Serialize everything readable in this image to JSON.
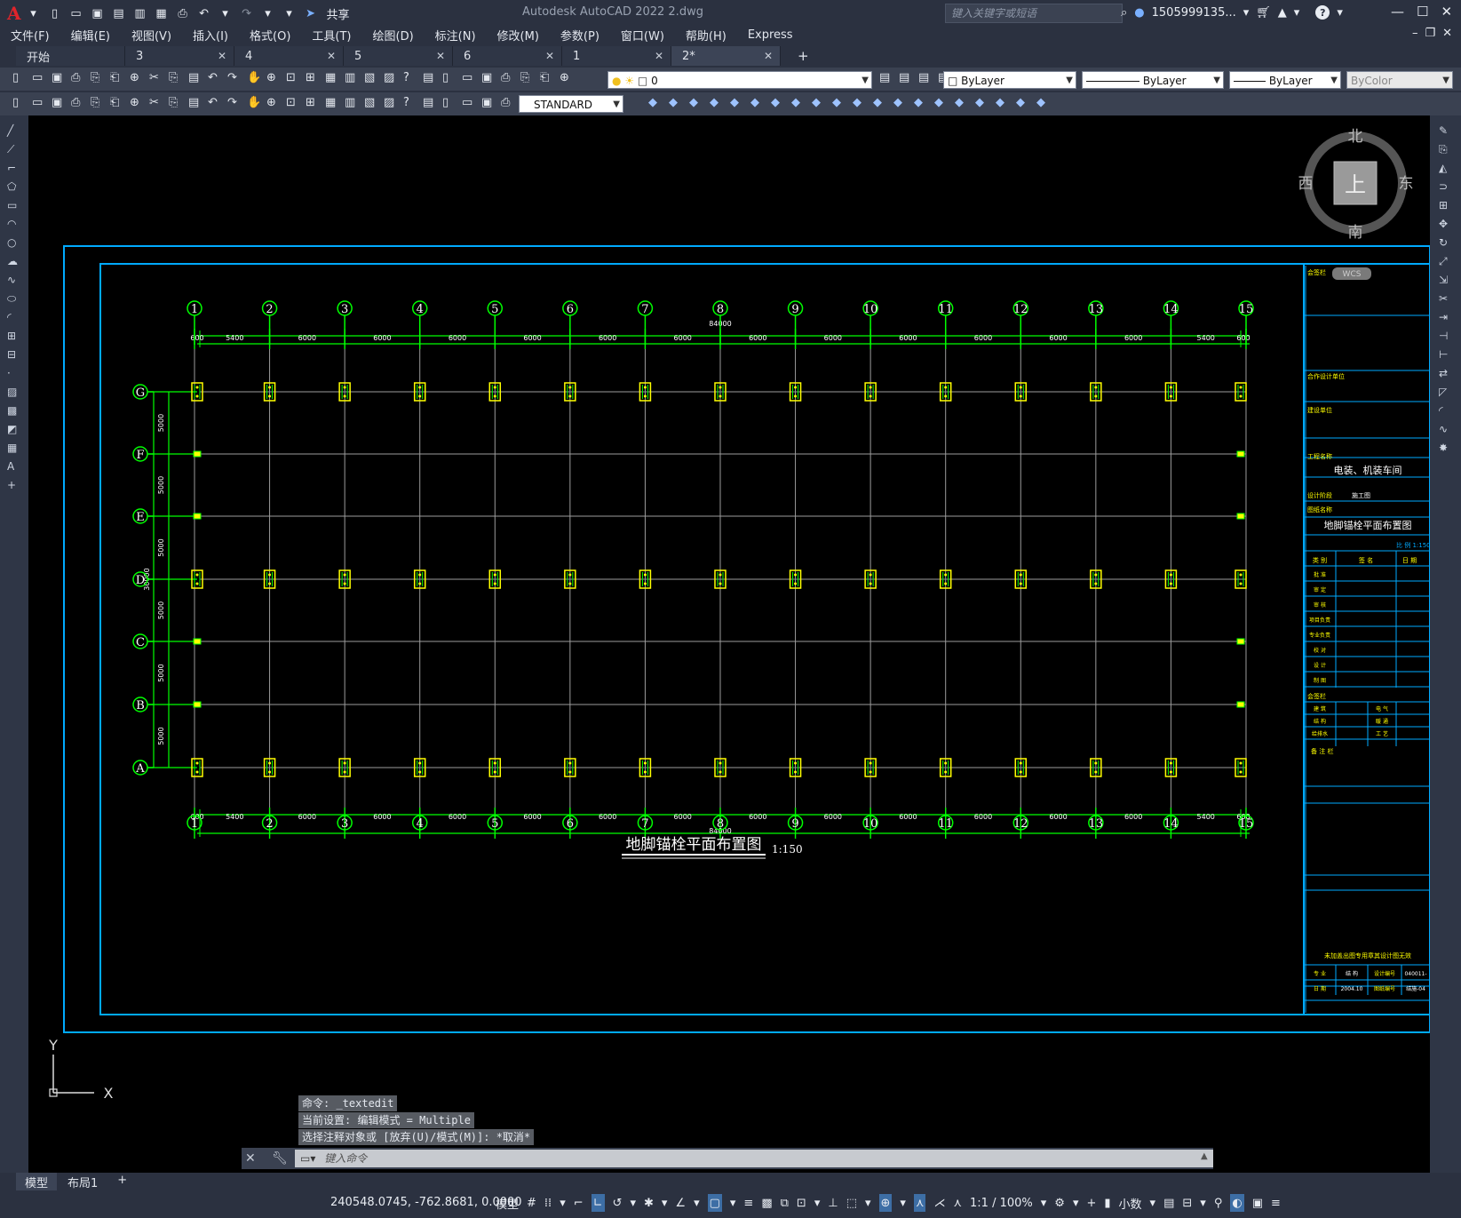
{
  "app": {
    "title": "Autodesk AutoCAD 2022    2.dwg",
    "share_label": "共享",
    "search_placeholder": "键入关键字或短语",
    "user": "1505999135...",
    "logo": "A"
  },
  "menu": [
    "文件(F)",
    "编辑(E)",
    "视图(V)",
    "插入(I)",
    "格式(O)",
    "工具(T)",
    "绘图(D)",
    "标注(N)",
    "修改(M)",
    "参数(P)",
    "窗口(W)",
    "帮助(H)",
    "Express"
  ],
  "file_tabs": [
    {
      "label": "开始",
      "close": "",
      "active": false
    },
    {
      "label": "3",
      "close": "✕",
      "active": false
    },
    {
      "label": "4",
      "close": "✕",
      "active": false
    },
    {
      "label": "5",
      "close": "✕",
      "active": false
    },
    {
      "label": "6",
      "close": "✕",
      "active": false
    },
    {
      "label": "1",
      "close": "✕",
      "active": false
    },
    {
      "label": "2*",
      "close": "✕",
      "active": true
    }
  ],
  "tab_add": "+",
  "properties": {
    "layer": "0",
    "color": "ByLayer",
    "linetype": "ByLayer",
    "lineweight": "ByLayer",
    "plotstyle": "ByColor",
    "textstyle": "STANDARD"
  },
  "viewcube": {
    "north": "北",
    "south": "南",
    "east": "东",
    "west": "西",
    "face": "上",
    "wcs": "WCS"
  },
  "drawing": {
    "title": "地脚锚栓平面布置图",
    "scale": "1:150",
    "col_labels": [
      "1",
      "2",
      "3",
      "4",
      "5",
      "6",
      "7",
      "8",
      "9",
      "10",
      "11",
      "12",
      "13",
      "14",
      "15"
    ],
    "row_labels": [
      "G",
      "F",
      "E",
      "D",
      "C",
      "B",
      "A"
    ],
    "col_dims": [
      "600",
      "5400",
      "6000",
      "6000",
      "6000",
      "6000",
      "6000",
      "6000",
      "6000",
      "6000",
      "6000",
      "6000",
      "6000",
      "6000",
      "5400",
      "600"
    ],
    "total_dim": "84000",
    "row_dims": [
      "5000",
      "5000",
      "5000",
      "5000",
      "5000",
      "5000"
    ],
    "total_row_dim": "30000"
  },
  "titleblock": {
    "seal_label": "会签栏",
    "coop_label": "合作设计单位",
    "client_label": "建设单位",
    "project_label": "工程名称",
    "project_name": "电装、机装车间",
    "stage_label": "设计阶段",
    "stage_value": "施工图",
    "drawing_label": "图纸名称",
    "drawing_name": "地脚锚栓平面布置图",
    "scale_label": "比 例 1:150",
    "sig_header": [
      "类 别",
      "签 名",
      "日 期"
    ],
    "sig_rows": [
      "批 准",
      "审 定",
      "审 核",
      "项目负责",
      "专业负责",
      "校 对",
      "设 计",
      "制 图"
    ],
    "countersign_label": "会签栏",
    "trade_rows": [
      [
        "建 筑",
        "电 气"
      ],
      [
        "结 构",
        "暖 通"
      ],
      [
        "给排水",
        "工 艺"
      ]
    ],
    "remark_label": "备 注 栏",
    "footer_note": "未加盖出图专用章其设计图无效",
    "footer_rows": [
      [
        "专 业",
        "结 构",
        "设计编号",
        "040011-"
      ],
      [
        "日 期",
        "2004.10",
        "图纸编号",
        "结施-04"
      ]
    ]
  },
  "ucs": {
    "x": "X",
    "y": "Y"
  },
  "command": {
    "history": [
      "命令: _textedit",
      "当前设置: 编辑模式 = Multiple",
      "选择注释对象或 [放弃(U)/模式(M)]: *取消*"
    ],
    "placeholder": "键入命令"
  },
  "layout_tabs": [
    "模型",
    "布局1",
    "+"
  ],
  "status": {
    "coords": "240548.0745, -762.8681, 0.0000",
    "model": "模型",
    "annoscale": "1:1 / 100%",
    "units": "小数"
  },
  "colors": {
    "cad_bg": "#000000",
    "frame": "#00aaff",
    "grid_green": "#00ff00",
    "axis_white": "#ffffff",
    "anchor_yellow": "#ffff00",
    "grid_gray": "#9c9c9c"
  }
}
